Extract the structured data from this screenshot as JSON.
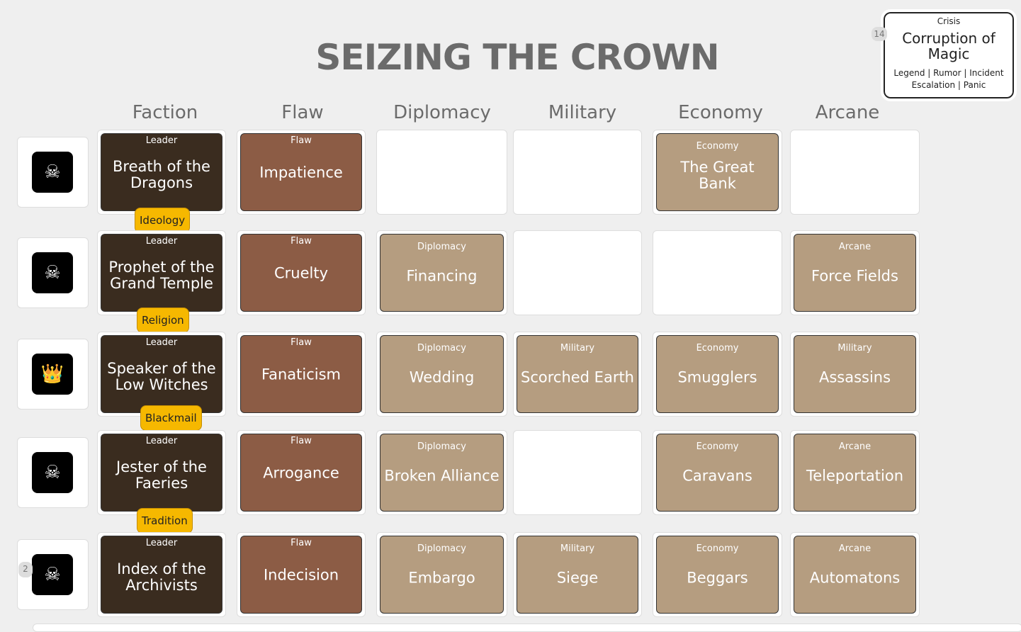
{
  "title": "SEIZING THE CROWN",
  "columns": [
    "Faction",
    "Flaw",
    "Diplomacy",
    "Military",
    "Economy",
    "Arcane"
  ],
  "crisis": {
    "type": "Crisis",
    "name": "Corruption of Magic",
    "keywords_1": "Legend | Rumor | Incident",
    "keywords_2": "Escalation | Panic",
    "count": "14"
  },
  "rows": [
    {
      "icon": "skull-crossbones-icon",
      "icon_glyph": "☠",
      "leader": {
        "type": "Leader",
        "name": "Breath of the Dragons"
      },
      "flaw": {
        "type": "Flaw",
        "name": "Impatience"
      },
      "diplomacy": null,
      "military": null,
      "economy": {
        "type": "Economy",
        "name": "The Great Bank"
      },
      "arcane": null,
      "tag": "Ideology"
    },
    {
      "icon": "skull-crossbones-icon",
      "icon_glyph": "☠",
      "leader": {
        "type": "Leader",
        "name": "Prophet of the Grand Temple"
      },
      "flaw": {
        "type": "Flaw",
        "name": "Cruelty"
      },
      "diplomacy": {
        "type": "Diplomacy",
        "name": "Financing"
      },
      "military": null,
      "economy": null,
      "arcane": {
        "type": "Arcane",
        "name": "Force Fields"
      },
      "tag": "Religion"
    },
    {
      "icon": "crown-icon",
      "icon_glyph": "👑",
      "leader": {
        "type": "Leader",
        "name": "Speaker of the Low Witches"
      },
      "flaw": {
        "type": "Flaw",
        "name": "Fanaticism"
      },
      "diplomacy": {
        "type": "Diplomacy",
        "name": "Wedding"
      },
      "military": {
        "type": "Military",
        "name": "Scorched Earth"
      },
      "economy": {
        "type": "Economy",
        "name": "Smugglers"
      },
      "arcane": {
        "type": "Military",
        "name": "Assassins"
      },
      "tag": "Blackmail"
    },
    {
      "icon": "skull-crossbones-icon",
      "icon_glyph": "☠",
      "leader": {
        "type": "Leader",
        "name": "Jester of the Faeries"
      },
      "flaw": {
        "type": "Flaw",
        "name": "Arrogance"
      },
      "diplomacy": {
        "type": "Diplomacy",
        "name": "Broken Alliance"
      },
      "military": null,
      "economy": {
        "type": "Economy",
        "name": "Caravans"
      },
      "arcane": {
        "type": "Arcane",
        "name": "Teleportation"
      },
      "tag": "Tradition"
    },
    {
      "icon": "skull-crossbones-icon",
      "icon_glyph": "☠",
      "leader": {
        "type": "Leader",
        "name": "Index of the Archivists"
      },
      "flaw": {
        "type": "Flaw",
        "name": "Indecision"
      },
      "diplomacy": {
        "type": "Diplomacy",
        "name": "Embargo"
      },
      "military": {
        "type": "Military",
        "name": "Siege"
      },
      "economy": {
        "type": "Economy",
        "name": "Beggars"
      },
      "arcane": {
        "type": "Arcane",
        "name": "Automatons"
      },
      "tag": null,
      "badge": "2"
    }
  ]
}
